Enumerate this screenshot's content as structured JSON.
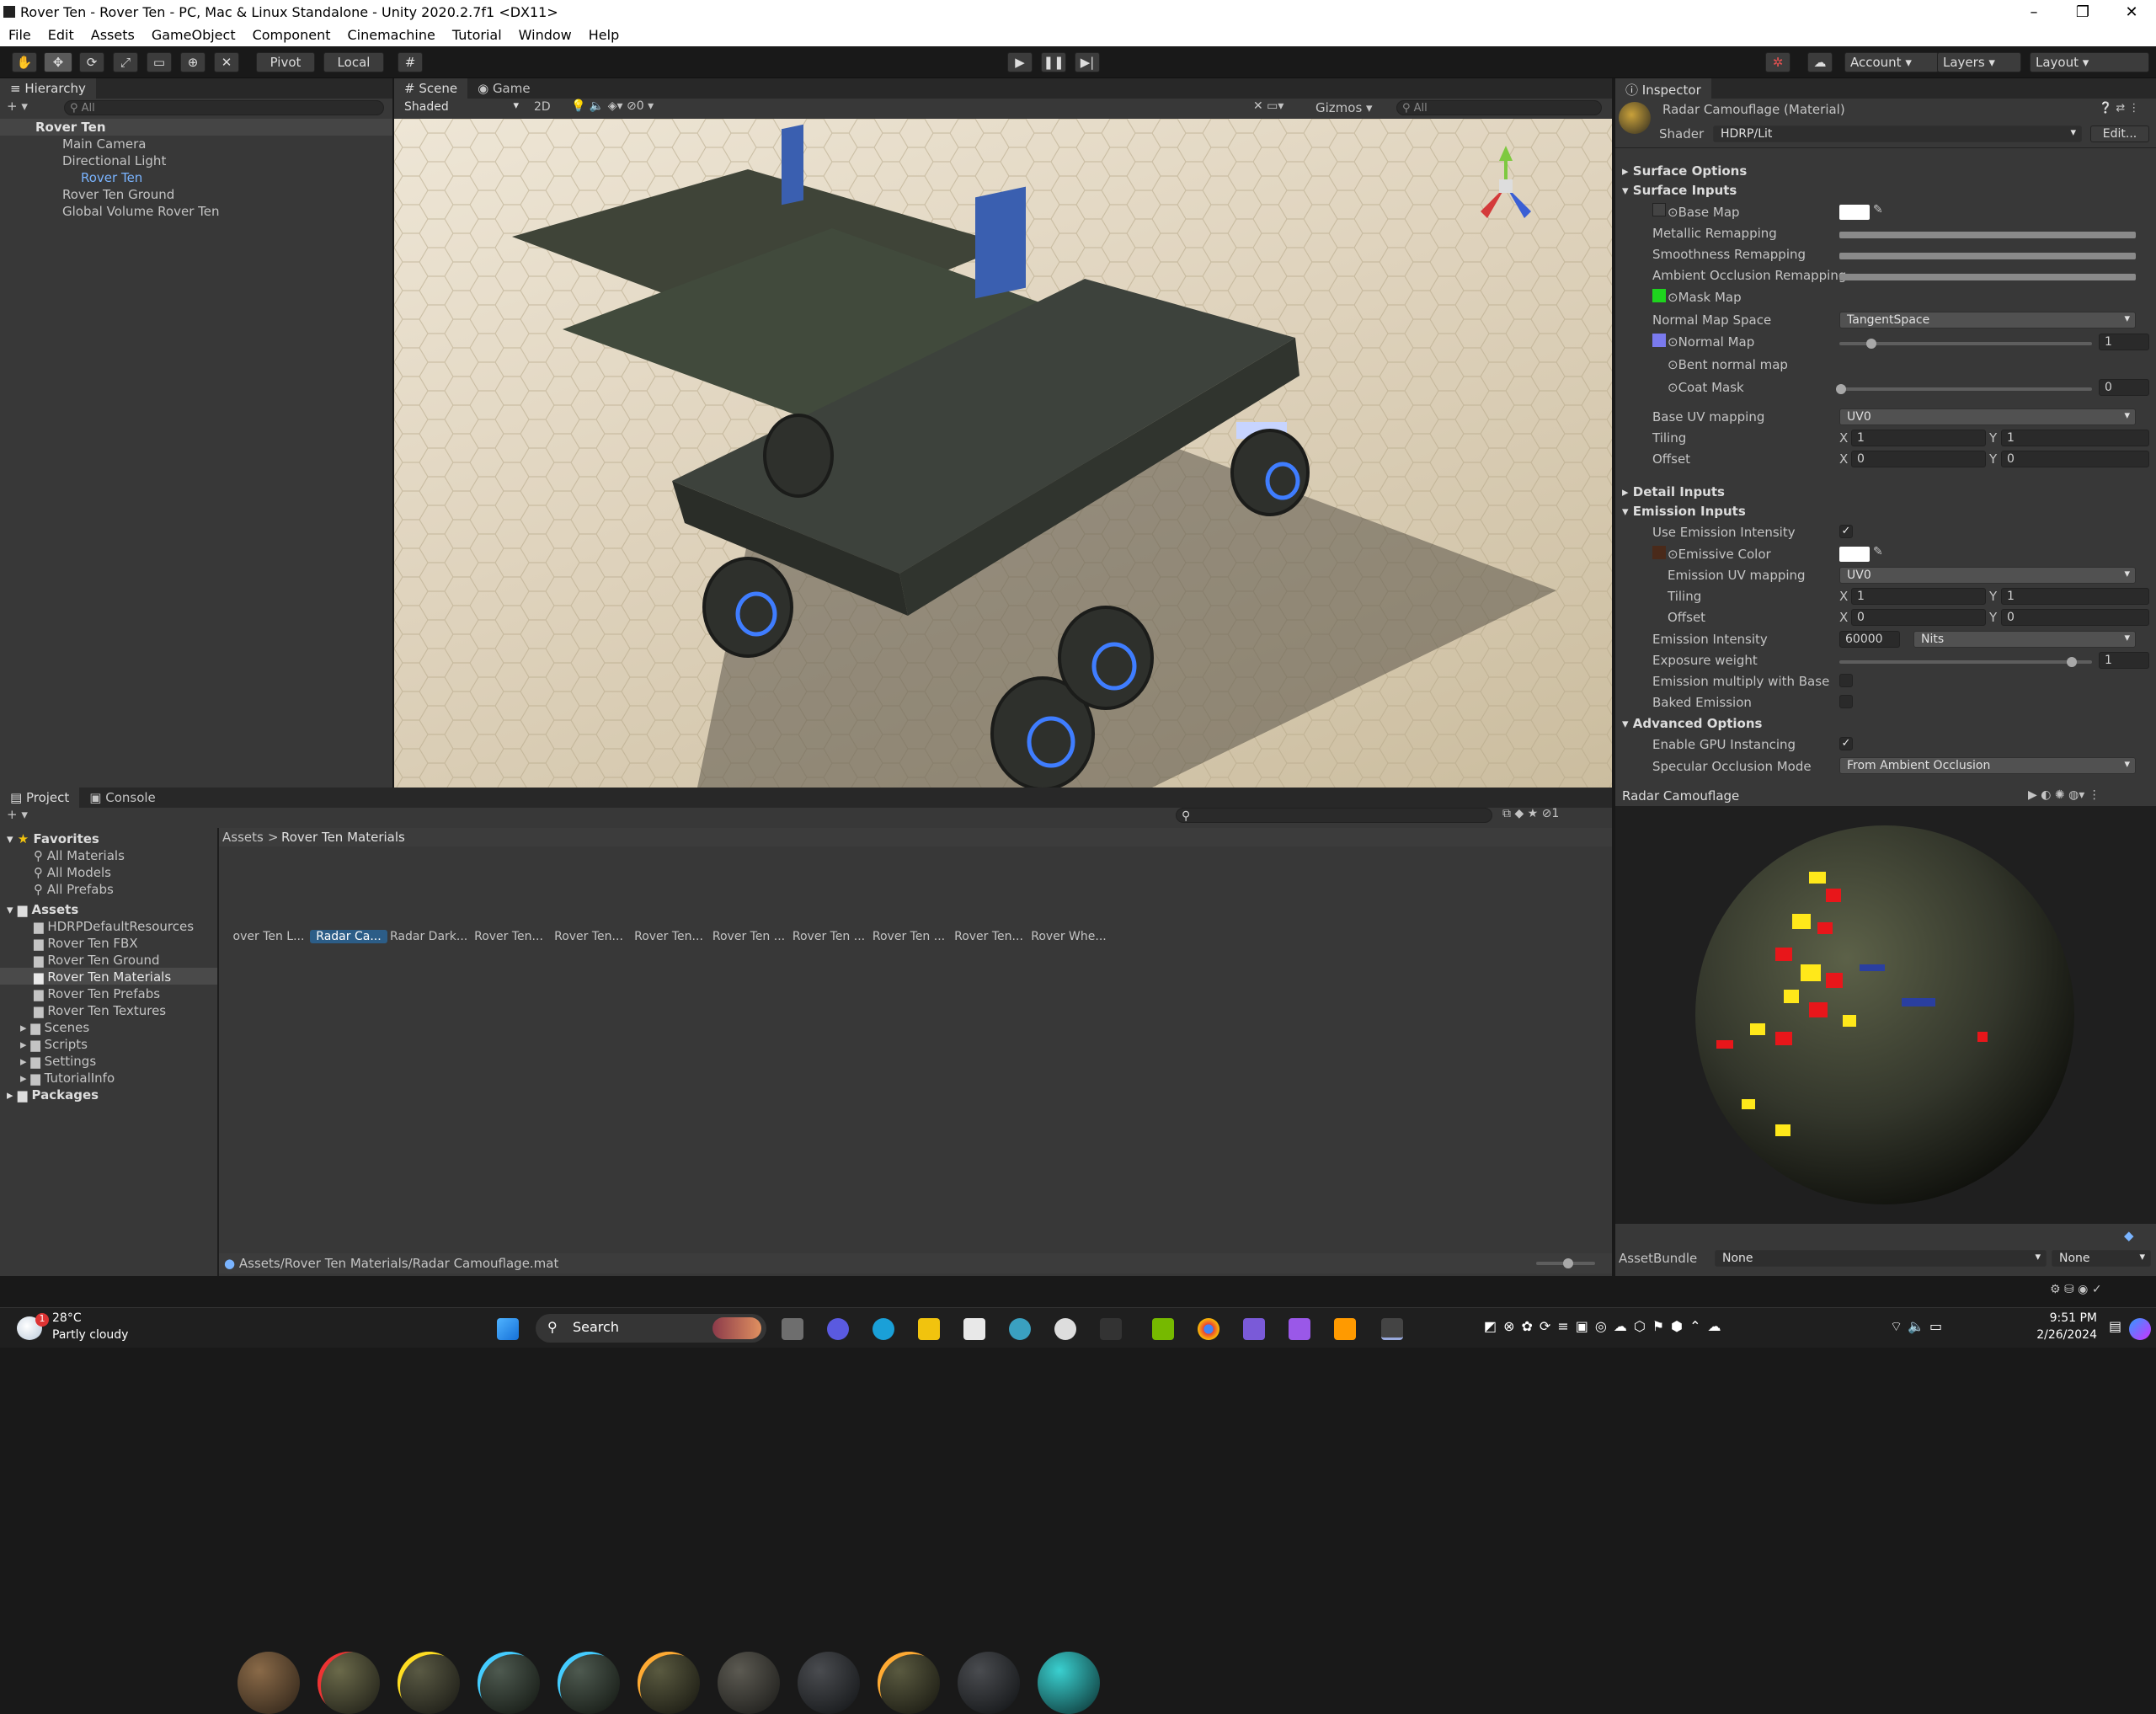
{
  "window": {
    "title": "Rover Ten - Rover Ten - PC, Mac & Linux Standalone - Unity 2020.2.7f1 <DX11>"
  },
  "menu": [
    "File",
    "Edit",
    "Assets",
    "GameObject",
    "Component",
    "Cinemachine",
    "Tutorial",
    "Window",
    "Help"
  ],
  "toolbar": {
    "pivot": "Pivot",
    "local": "Local",
    "account": "Account",
    "layers": "Layers",
    "layout": "Layout"
  },
  "hierarchy": {
    "tab": "Hierarchy",
    "search_placeholder": "All",
    "scene": "Rover Ten",
    "items": [
      "Main Camera",
      "Directional Light",
      "Rover Ten",
      "Rover Ten Ground",
      "Global Volume Rover Ten"
    ]
  },
  "scene_view": {
    "tabs": [
      "Scene",
      "Game"
    ],
    "shading": "Shaded",
    "mode2d": "2D",
    "gizmos": "Gizmos",
    "search_placeholder": "All",
    "hidden_count": "0"
  },
  "inspector": {
    "tab": "Inspector",
    "material": "Radar Camouflage (Material)",
    "shader_label": "Shader",
    "shader": "HDRP/Lit",
    "edit": "Edit...",
    "surface_options": "Surface Options",
    "surface_inputs": "Surface Inputs",
    "base_map": "Base Map",
    "metallic": "Metallic Remapping",
    "smoothness": "Smoothness Remapping",
    "ao": "Ambient Occlusion Remapping",
    "mask_map": "Mask Map",
    "normal_space_label": "Normal Map Space",
    "normal_space": "TangentSpace",
    "normal_map": "Normal Map",
    "normal_value": "1",
    "bent_normal": "Bent normal map",
    "coat_mask": "Coat Mask",
    "coat_value": "0",
    "base_uv_label": "Base UV mapping",
    "base_uv": "UV0",
    "tiling": "Tiling",
    "offset": "Offset",
    "x": "X",
    "y": "Y",
    "tiling_x": "1",
    "tiling_y": "1",
    "offset_x": "0",
    "offset_y": "0",
    "detail_inputs": "Detail Inputs",
    "emission_inputs": "Emission Inputs",
    "use_emission_intensity": "Use Emission Intensity",
    "emissive_color": "Emissive Color",
    "emission_uv_label": "Emission UV mapping",
    "emission_uv": "UV0",
    "e_tiling_x": "1",
    "e_tiling_y": "1",
    "e_offset_x": "0",
    "e_offset_y": "0",
    "emission_intensity_label": "Emission Intensity",
    "emission_intensity": "60000",
    "emission_unit": "Nits",
    "exposure_label": "Exposure weight",
    "exposure_value": "1",
    "emission_mult": "Emission multiply with Base",
    "baked_emission": "Baked Emission",
    "advanced": "Advanced Options",
    "gpu_instancing": "Enable GPU Instancing",
    "specular_label": "Specular Occlusion Mode",
    "specular": "From Ambient Occlusion"
  },
  "preview": {
    "title": "Radar Camouflage",
    "assetbundle": "AssetBundle",
    "ab_name": "None",
    "ab_variant": "None"
  },
  "project": {
    "tabs": [
      "Project",
      "Console"
    ],
    "favorites": "Favorites",
    "fav_items": [
      "All Materials",
      "All Models",
      "All Prefabs"
    ],
    "assets": "Assets",
    "folders": [
      "HDRPDefaultResources",
      "Rover Ten FBX",
      "Rover Ten Ground",
      "Rover Ten Materials",
      "Rover Ten Prefabs",
      "Rover Ten Textures",
      "Scenes",
      "Scripts",
      "Settings",
      "TutorialInfo"
    ],
    "packages": "Packages",
    "breadcrumb": [
      "Assets",
      "Rover Ten Materials"
    ],
    "materials": [
      "over Ten L...",
      "Radar Ca...",
      "Radar Dark...",
      "Rover Ten...",
      "Rover Ten...",
      "Rover Ten...",
      "Rover Ten ...",
      "Rover Ten ...",
      "Rover Ten ...",
      "Rover Ten...",
      "Rover Whe..."
    ],
    "selected_path": "Assets/Rover Ten Materials/Radar Camouflage.mat",
    "hidden_count": "1"
  },
  "taskbar": {
    "weather_temp": "28°C",
    "weather_desc": "Partly cloudy",
    "search": "Search",
    "time": "9:51 PM",
    "date": "2/26/2024",
    "badge": "1"
  }
}
